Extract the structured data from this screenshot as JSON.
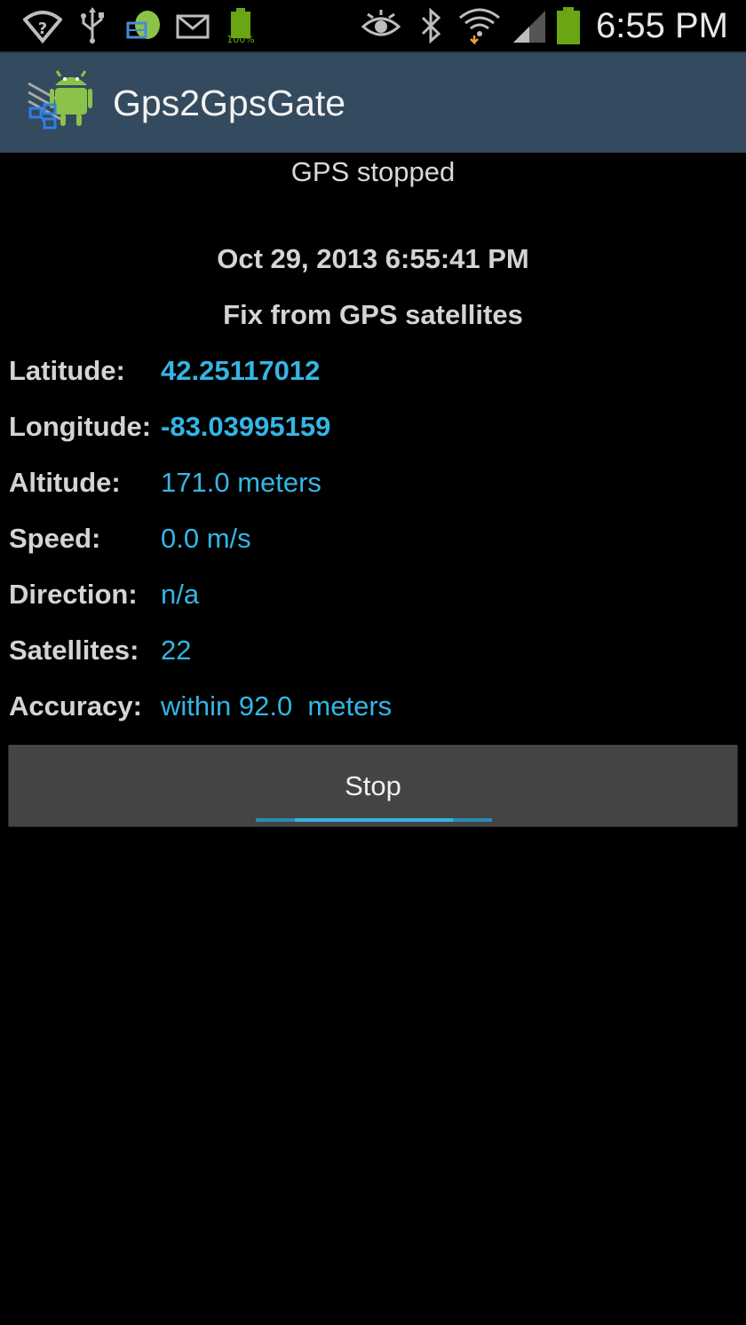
{
  "status_bar": {
    "time": "6:55 PM",
    "battery_notification_text": "100%",
    "icons": [
      "wifi-question-icon",
      "usb-icon",
      "app-notification-icon",
      "email-icon",
      "battery-full-icon",
      "eye-icon",
      "bluetooth-icon",
      "wifi-signal-icon",
      "cellular-signal-icon",
      "battery-icon"
    ],
    "colors": {
      "battery_green": "#6aa514",
      "icon_grey": "#bdbdbd"
    }
  },
  "action_bar": {
    "title": "Gps2GpsGate",
    "background": "#344a5e",
    "logo_icon": "android-gps-app-icon"
  },
  "gps": {
    "status": "GPS stopped",
    "timestamp": "Oct 29, 2013 6:55:41 PM",
    "fix_source": "Fix from GPS satellites",
    "rows": [
      {
        "label": "Latitude:",
        "value": "42.25117012"
      },
      {
        "label": "Longitude:",
        "value": "-83.03995159"
      },
      {
        "label": "Altitude:",
        "value": "171.0 meters"
      },
      {
        "label": "Speed:",
        "value": "0.0 m/s"
      },
      {
        "label": "Direction:",
        "value": "n/a"
      },
      {
        "label": "Satellites:",
        "value": "22"
      },
      {
        "label": "Accuracy:",
        "value": "within 92.0  meters"
      }
    ],
    "value_color": "#35b5e5"
  },
  "actions": {
    "stop_label": "Stop",
    "accent": "#33b5e5"
  }
}
